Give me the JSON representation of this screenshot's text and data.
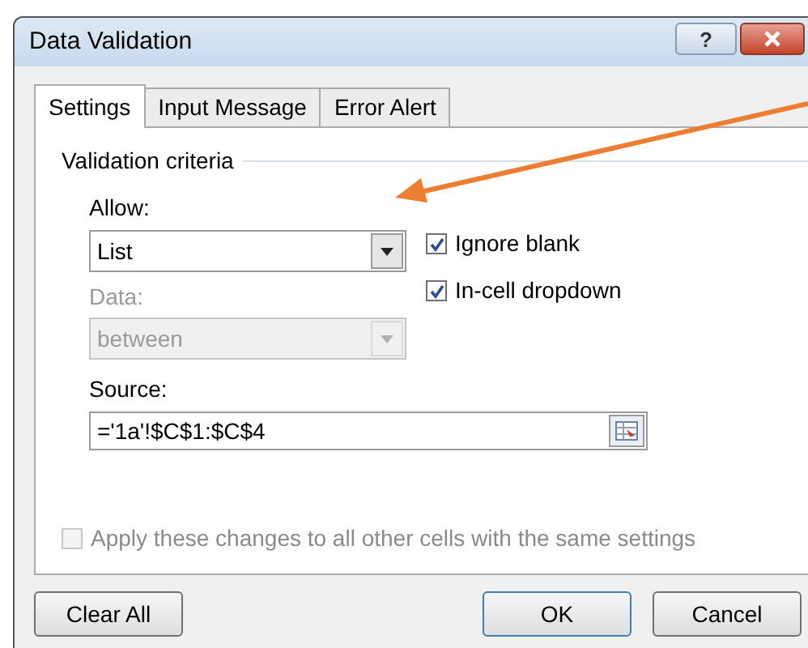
{
  "window": {
    "title": "Data Validation",
    "help": "?"
  },
  "tabs": [
    {
      "label": "Settings",
      "selected": true
    },
    {
      "label": "Input Message",
      "selected": false
    },
    {
      "label": "Error Alert",
      "selected": false
    }
  ],
  "group_title": "Validation criteria",
  "allow": {
    "label": "Allow:",
    "value": "List",
    "disabled": false
  },
  "data": {
    "label": "Data:",
    "value": "between",
    "disabled": true
  },
  "options": [
    {
      "label": "Ignore blank",
      "checked": true
    },
    {
      "label": "In-cell dropdown",
      "checked": true
    }
  ],
  "source": {
    "label": "Source:",
    "value": "='1a'!$C$1:$C$4"
  },
  "apply_all": {
    "label": "Apply these changes to all other cells with the same settings",
    "checked": false,
    "disabled": true
  },
  "buttons": [
    {
      "label": "Clear All",
      "kind": "left"
    },
    {
      "label": "OK",
      "kind": "default"
    },
    {
      "label": "Cancel",
      "kind": "right"
    }
  ]
}
